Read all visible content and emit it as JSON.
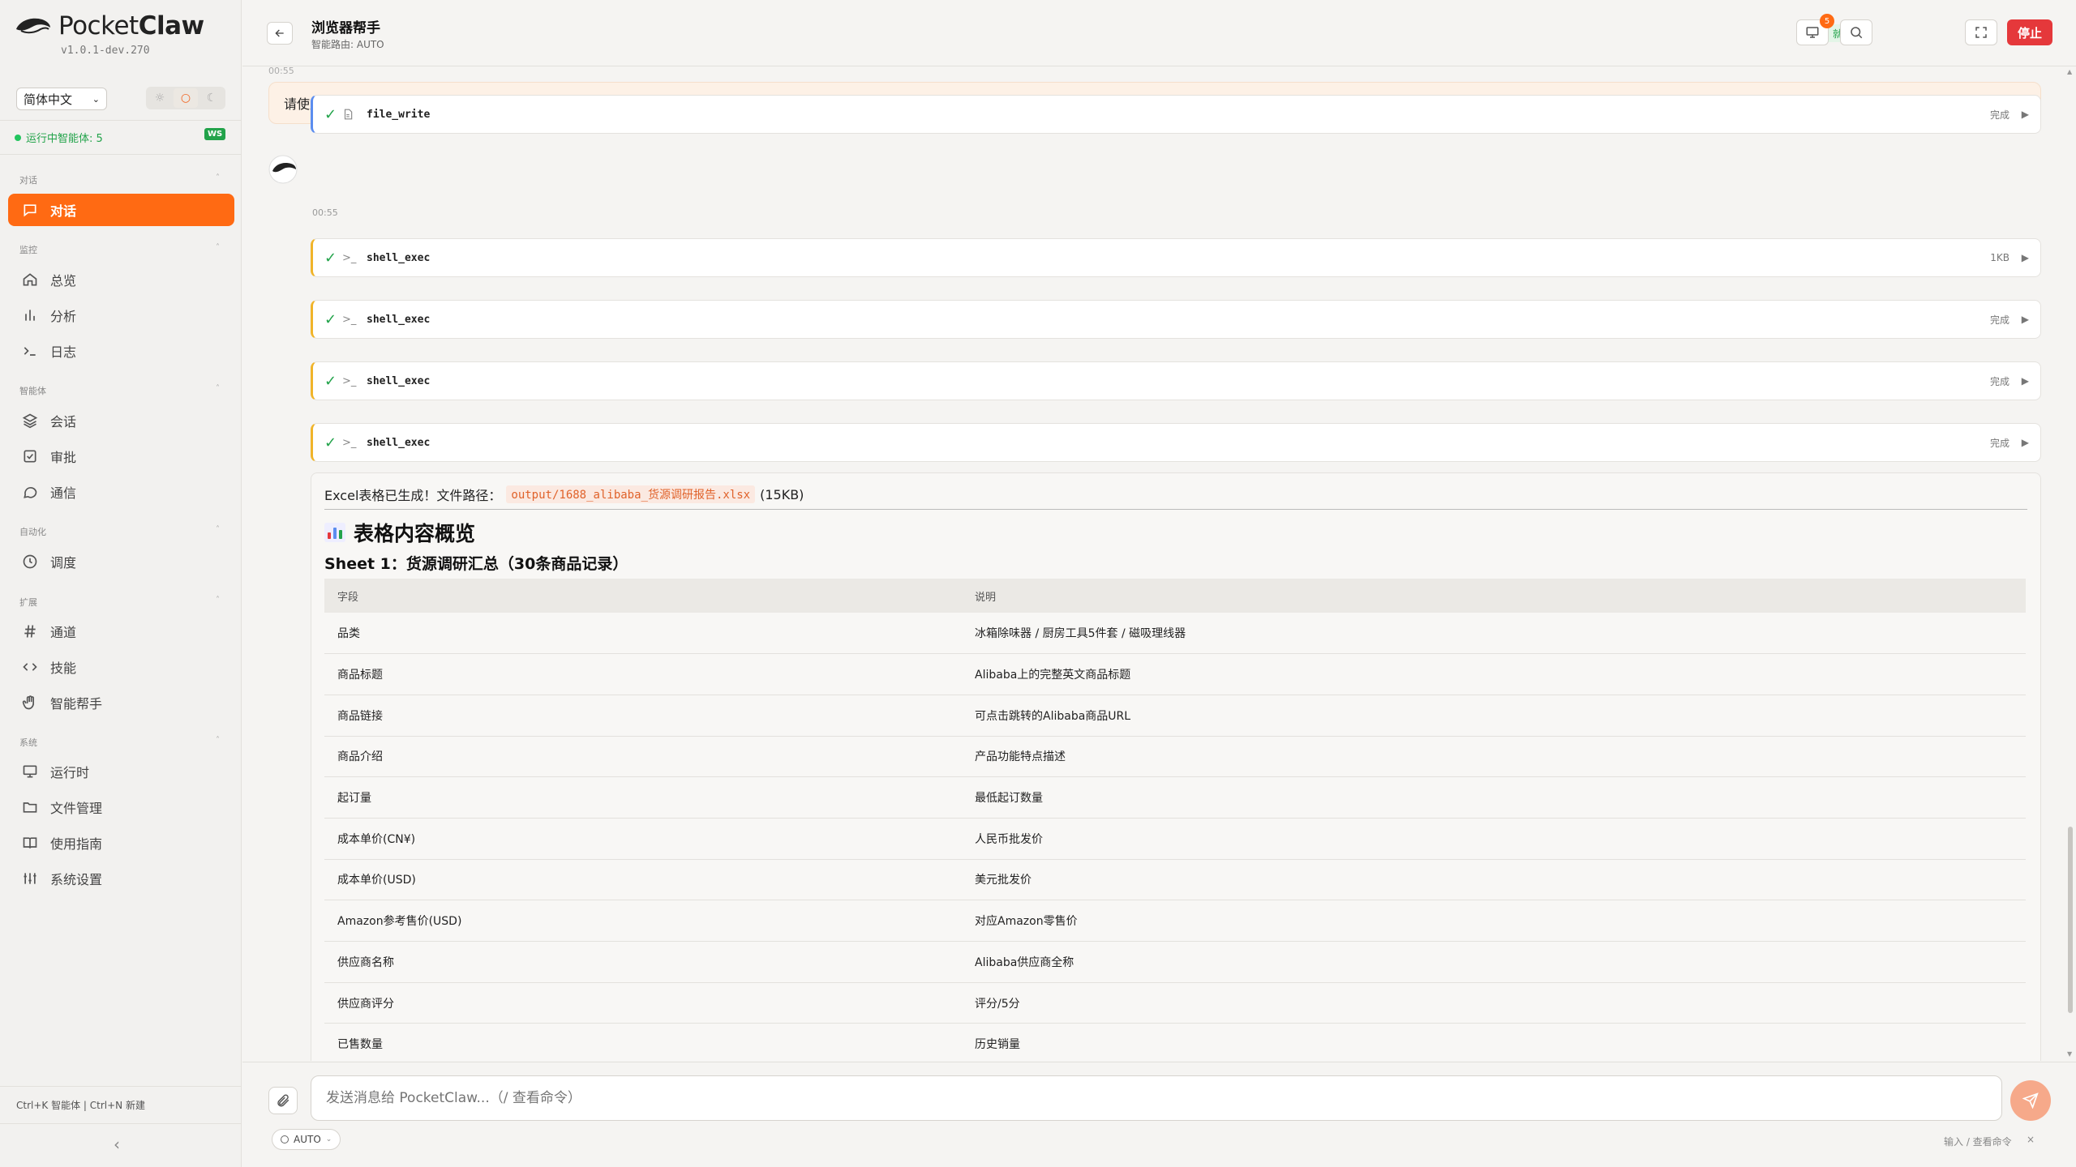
{
  "app": {
    "name_light": "Pocket",
    "name_bold": "Claw",
    "version": "v1.0.1-dev.270"
  },
  "sidebar": {
    "language": "简体中文",
    "theme_options": [
      "☼",
      "○",
      "☾"
    ],
    "running_label": "运行中智能体: 5",
    "ws_badge": "WS",
    "sections": [
      {
        "label": "对话",
        "items": [
          {
            "label": "对话",
            "icon": "chat-icon",
            "active": true
          }
        ]
      },
      {
        "label": "监控",
        "items": [
          {
            "label": "总览",
            "icon": "home-icon"
          },
          {
            "label": "分析",
            "icon": "bar-chart-icon"
          },
          {
            "label": "日志",
            "icon": "terminal-icon"
          }
        ]
      },
      {
        "label": "智能体",
        "items": [
          {
            "label": "会话",
            "icon": "layers-icon"
          },
          {
            "label": "审批",
            "icon": "checkbox-icon"
          },
          {
            "label": "通信",
            "icon": "message-circle-icon"
          }
        ]
      },
      {
        "label": "自动化",
        "items": [
          {
            "label": "调度",
            "icon": "clock-icon"
          }
        ]
      },
      {
        "label": "扩展",
        "items": [
          {
            "label": "通道",
            "icon": "hash-icon"
          },
          {
            "label": "技能",
            "icon": "code-icon"
          },
          {
            "label": "智能帮手",
            "icon": "hand-icon"
          }
        ]
      },
      {
        "label": "系统",
        "items": [
          {
            "label": "运行时",
            "icon": "monitor-icon"
          },
          {
            "label": "文件管理",
            "icon": "folder-icon"
          },
          {
            "label": "使用指南",
            "icon": "book-icon"
          },
          {
            "label": "系统设置",
            "icon": "sliders-icon"
          }
        ]
      }
    ],
    "shortcut_hint": "Ctrl+K 智能体 | Ctrl+N 新建",
    "collapse_icon": "‹"
  },
  "header": {
    "title": "浏览器帮手",
    "subtitle": "智能路由: AUTO",
    "status": "就绪",
    "notification_count": "5",
    "stop_label": "停止"
  },
  "chat": {
    "top_timestamp": "00:55",
    "user_message": "请使用文档帮手 将你收集的信息汇总到excel表格中，需要包含商品链接、商品标题，商品介绍，商品主图、起订量，成本单价。",
    "first_tool": {
      "name": "file_write",
      "status": "完成",
      "icon": "file-icon"
    },
    "mid_timestamp": "00:55",
    "tools": [
      {
        "name": "shell_exec",
        "status": "1KB",
        "icon": "terminal-icon"
      },
      {
        "name": "shell_exec",
        "status": "完成",
        "icon": "terminal-icon"
      },
      {
        "name": "shell_exec",
        "status": "完成",
        "icon": "terminal-icon"
      },
      {
        "name": "shell_exec",
        "status": "完成",
        "icon": "terminal-icon"
      }
    ],
    "result": {
      "prefix": "Excel表格已生成！文件路径：",
      "path": "output/1688_alibaba_货源调研报告.xlsx",
      "size": "(15KB)",
      "heading": "表格内容概览",
      "sheet_title": "Sheet 1：货源调研汇总（30条商品记录）",
      "columns": [
        "字段",
        "说明"
      ],
      "rows": [
        [
          "品类",
          "冰箱除味器 / 厨房工具5件套 / 磁吸理线器"
        ],
        [
          "商品标题",
          "Alibaba上的完整英文商品标题"
        ],
        [
          "商品链接",
          "可点击跳转的Alibaba商品URL"
        ],
        [
          "商品介绍",
          "产品功能特点描述"
        ],
        [
          "起订量",
          "最低起订数量"
        ],
        [
          "成本单价(CN¥)",
          "人民币批发价"
        ],
        [
          "成本单价(USD)",
          "美元批发价"
        ],
        [
          "Amazon参考售价(USD)",
          "对应Amazon零售价"
        ],
        [
          "供应商名称",
          "Alibaba供应商全称"
        ],
        [
          "供应商评分",
          "评分/5分"
        ],
        [
          "已售数量",
          "历史销量"
        ]
      ]
    }
  },
  "composer": {
    "placeholder": "发送消息给 PocketClaw...（/ 查看命令）",
    "mode": "AUTO",
    "hint": "输入 / 查看命令",
    "hint_close": "×"
  },
  "colors": {
    "accent": "#ff6a13",
    "stop": "#e5383b",
    "success": "#22a34a"
  }
}
